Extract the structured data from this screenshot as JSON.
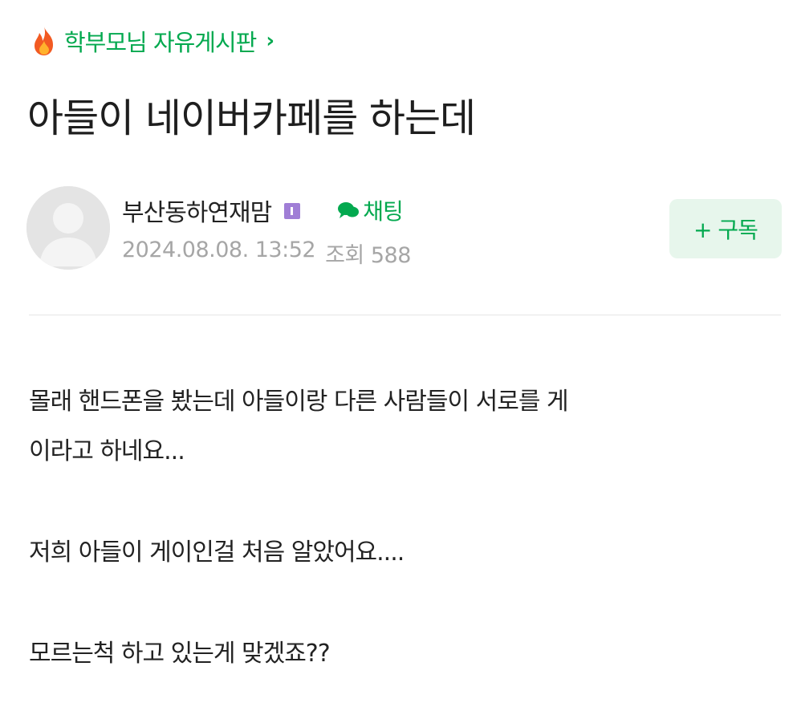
{
  "board": {
    "icon": "fire-icon",
    "label": "학부모님 자유게시판",
    "chevron": "›"
  },
  "post": {
    "title": "아들이 네이버카페를 하는데",
    "author": {
      "avatar": "default-avatar-icon",
      "name": "부산동하연재맘",
      "level_badge": "level-1-badge-icon",
      "chat_label": "채팅"
    },
    "date": "2024.08.08. 13:52",
    "views_label": "조회 588",
    "subscribe_label": "+ 구독",
    "body": {
      "line1": "몰래 핸드폰을 봤는데 아들이랑 다른 사람들이 서로를 게",
      "line2": "이라고 하네요...",
      "line3": "저희 아들이 게이인걸 처음 알았어요....",
      "line4": "모르는척 하고 있는게 맞겠죠??"
    }
  },
  "colors": {
    "accent_green": "#03a94f",
    "subscribe_bg": "#e7f6ec",
    "meta_gray": "#a6a6a6",
    "badge_purple": "#a07ed6"
  }
}
